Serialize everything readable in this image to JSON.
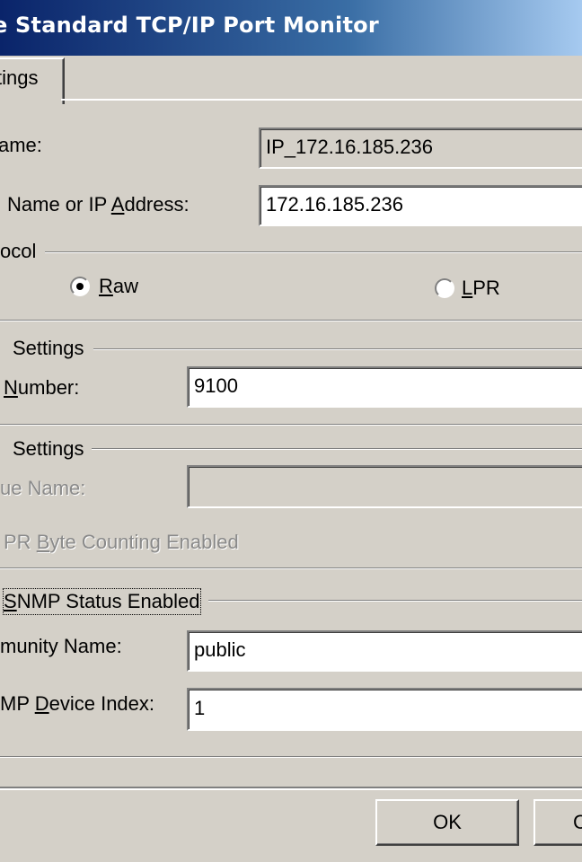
{
  "window": {
    "title": "e Standard TCP/IP Port Monitor"
  },
  "tabs": [
    {
      "label": "tings"
    }
  ],
  "port_name": {
    "label": "ame:",
    "value": "IP_172.16.185.236"
  },
  "host": {
    "label": "Name or IP Address:",
    "value": "172.16.185.236"
  },
  "protocol": {
    "group_label": "ocol",
    "options": [
      {
        "label": "Raw",
        "selected": true
      },
      {
        "label": "LPR",
        "selected": false
      }
    ]
  },
  "raw_settings": {
    "group_label": "Settings",
    "port_number_label": "Number:",
    "port_number_value": "9100"
  },
  "lpr_settings": {
    "group_label": "Settings",
    "queue_name_label": "ue Name:",
    "queue_name_value": "",
    "byte_counting_label": "PR Byte Counting Enabled"
  },
  "snmp": {
    "enabled_label": "SNMP Status Enabled",
    "community_label": "munity Name:",
    "community_value": "public",
    "device_index_label": "MP Device Index:",
    "device_index_value": "1"
  },
  "buttons": {
    "ok": "OK",
    "cancel": "C"
  },
  "colors": {
    "face": "#d4d0c8",
    "title_start": "#0a246a",
    "title_end": "#a6caf0"
  }
}
